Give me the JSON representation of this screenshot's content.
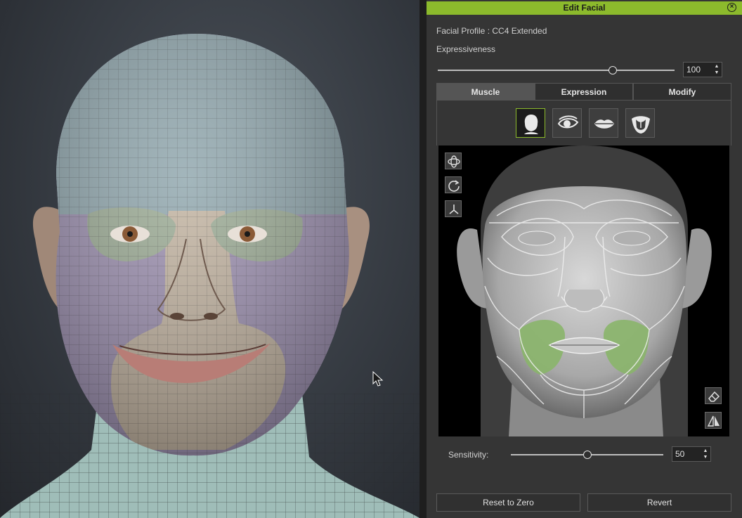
{
  "panel": {
    "title": "Edit Facial",
    "profile_label": "Facial Profile : CC4 Extended",
    "expressiveness": {
      "label": "Expressiveness",
      "value": "100",
      "fraction": 0.74
    },
    "tabs": [
      {
        "label": "Muscle",
        "active": true
      },
      {
        "label": "Expression",
        "active": false
      },
      {
        "label": "Modify",
        "active": false
      }
    ],
    "modes": [
      {
        "name": "head-icon",
        "active": true
      },
      {
        "name": "eye-icon",
        "active": false
      },
      {
        "name": "lips-icon",
        "active": false
      },
      {
        "name": "tongue-icon",
        "active": false
      }
    ],
    "sensitivity": {
      "label": "Sensitivity:",
      "value": "50",
      "fraction": 0.5
    },
    "buttons": {
      "reset": "Reset to Zero",
      "revert": "Revert"
    },
    "colors": {
      "accent": "#8cba2c",
      "selected_region": "#8ab56a"
    }
  }
}
